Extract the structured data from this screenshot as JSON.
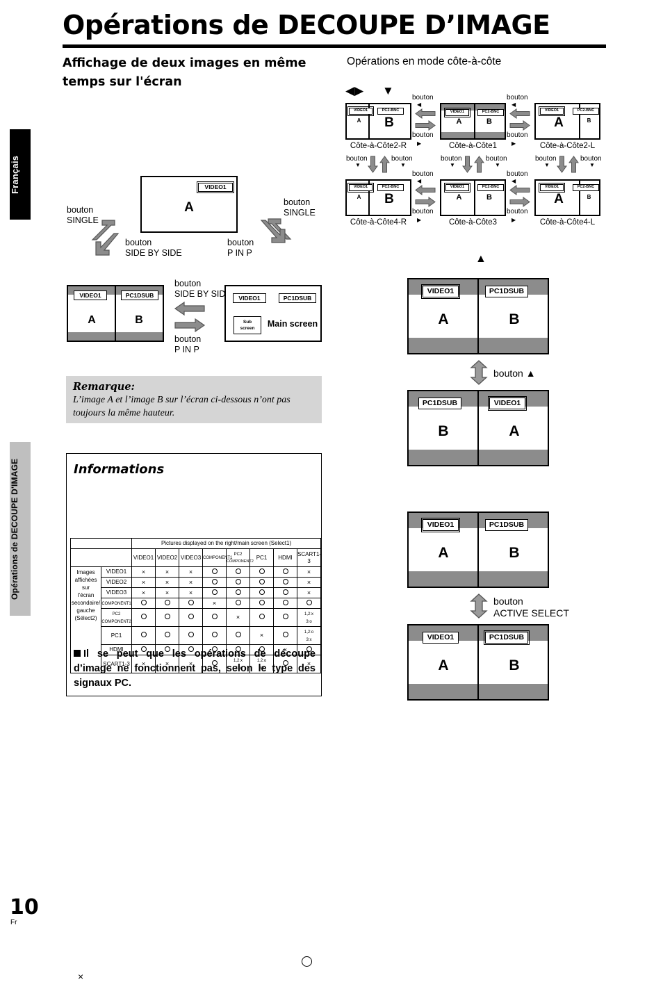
{
  "page": {
    "title_part1": "Opérations de ",
    "title_part2": "DECOUPE D’IMAGE",
    "number": "10",
    "number_sub": "Fr",
    "side_tab_language": "Français",
    "side_tab_section": "Opérations de DECOUPE D'IMAGE"
  },
  "headings": {
    "left": "Affichage de deux images en même temps sur l'écran",
    "right": "Opérations en mode côte-à-côte"
  },
  "labels": {
    "bouton": "bouton",
    "bouton_single": "bouton\nSINGLE",
    "single": "SINGLE",
    "side_by_side": "SIDE BY SIDE",
    "p_in_p": "P IN P",
    "active_select": "ACTIVE SELECT",
    "bouton_up": "bouton ▲",
    "left_right_arrows": "◀▶",
    "down_arrow": "▼",
    "up_arrow": "▲",
    "left_tri": "◀",
    "right_tri": "▶",
    "down_tri": "▼",
    "up_tri": "▲"
  },
  "single_screen": {
    "tag": "VIDEO1",
    "letter": "A",
    "left_btn_top": "bouton",
    "left_btn_top2": "SINGLE",
    "left_btn_bot": "bouton",
    "left_btn_bot2": "SIDE BY SIDE",
    "right_btn_top": "bouton",
    "right_btn_top2": "SINGLE",
    "right_btn_bot": "bouton",
    "right_btn_bot2": "P IN P"
  },
  "sbs_pip": {
    "left_screen": {
      "tag_a": "VIDEO1",
      "tag_b": "PC1DSUB",
      "letter_a": "A",
      "letter_b": "B"
    },
    "arrow_up_label1": "bouton",
    "arrow_up_label2": "SIDE BY SIDE",
    "arrow_down_label1": "bouton",
    "arrow_down_label2": "P IN P",
    "right_screen": {
      "tag_a": "VIDEO1",
      "tag_b": "PC1DSUB",
      "sub": "Sub\nscreen",
      "sub_l1": "Sub",
      "sub_l2": "screen",
      "main": "Main screen"
    }
  },
  "remarque": {
    "title": "Remarque:",
    "body": "L’image A et l’image B sur l’écran ci-dessous n’ont pas toujours la même hauteur."
  },
  "informations": {
    "title": "Informations",
    "legend_x": "×",
    "footnote": "Il se peut que les opérations de découpe d’image ne fonctionnent pas, selon le type des signaux PC.",
    "table": {
      "top_header": "Pictures displayed on the right/main screen (Select1)",
      "row_group_label": "Images affichées sur l’écran secondaire/ gauche (Sélect2)",
      "columns": [
        "VIDEO1",
        "VIDEO2",
        "VIDEO3",
        "COMPONENT1",
        "PC2 COMPONENT2",
        "PC1",
        "HDMI",
        "SCART1-3"
      ],
      "col_pc2_l1": "PC2",
      "col_pc2_l2": "COMPONENT2",
      "rows": [
        {
          "label": "VIDEO1",
          "cells": [
            "x",
            "x",
            "x",
            "o",
            "o",
            "o",
            "o",
            "x"
          ]
        },
        {
          "label": "VIDEO2",
          "cells": [
            "x",
            "x",
            "x",
            "o",
            "o",
            "o",
            "o",
            "x"
          ]
        },
        {
          "label": "VIDEO3",
          "cells": [
            "x",
            "x",
            "x",
            "o",
            "o",
            "o",
            "o",
            "x"
          ]
        },
        {
          "label": "COMPONENT1",
          "cells": [
            "o",
            "o",
            "o",
            "x",
            "o",
            "o",
            "o",
            "o"
          ]
        },
        {
          "label": "PC2 COMPONENT2",
          "label_l1": "PC2",
          "label_l2": "COMPONENT2",
          "cells": [
            "o",
            "o",
            "o",
            "o",
            "x",
            "o",
            "o",
            "1,2:x 3:o"
          ]
        },
        {
          "label": "PC1",
          "cells": [
            "o",
            "o",
            "o",
            "o",
            "o",
            "x",
            "o",
            "1,2:o 3:x"
          ]
        },
        {
          "label": "HDMI",
          "cells": [
            "o",
            "o",
            "o",
            "o",
            "o",
            "o",
            "x",
            "o"
          ]
        },
        {
          "label": "SCART1-3",
          "cells": [
            "x",
            "x",
            "x",
            "o",
            "1,2:x 3:o",
            "1,2:o 3:x",
            "o",
            "x"
          ]
        }
      ]
    }
  },
  "cote_grid": {
    "cells": [
      {
        "caption": "Côte-à-Côte2-R",
        "tag_a": "VIDEO1",
        "tag_b": "PC2-BNC",
        "letter_a": "A",
        "letter_b": "B",
        "variant": "right-big"
      },
      {
        "caption": "Côte-à-Côte1",
        "tag_a": "VIDEO1",
        "tag_b": "PC2-BNC",
        "letter_a": "A",
        "letter_b": "B",
        "variant": "even-band"
      },
      {
        "caption": "Côte-à-Côte2-L",
        "tag_a": "VIDEO1",
        "tag_b": "PC2-BNC",
        "letter_a": "A",
        "letter_b": "B",
        "variant": "left-big"
      },
      {
        "caption": "Côte-à-Côte4-R",
        "tag_a": "VIDEO1",
        "tag_b": "PC2-BNC",
        "letter_a": "A",
        "letter_b": "B",
        "variant": "right-big"
      },
      {
        "caption": "Côte-à-Côte3",
        "tag_a": "VIDEO1",
        "tag_b": "PC2-BNC",
        "letter_a": "A",
        "letter_b": "B",
        "variant": "even"
      },
      {
        "caption": "Côte-à-Côte4-L",
        "tag_a": "VIDEO1",
        "tag_b": "PC2-BNC",
        "letter_a": "A",
        "letter_b": "B",
        "variant": "left-big"
      }
    ]
  },
  "big_screens": {
    "s1": {
      "tag_a": "VIDEO1",
      "tag_b": "PC1DSUB",
      "letter_a": "A",
      "letter_b": "B",
      "selected": "a"
    },
    "s2": {
      "tag_a": "PC1DSUB",
      "tag_b": "VIDEO1",
      "letter_a": "B",
      "letter_b": "A",
      "selected": "b"
    },
    "s3": {
      "tag_a": "VIDEO1",
      "tag_b": "PC1DSUB",
      "letter_a": "A",
      "letter_b": "B",
      "selected": "a"
    },
    "s4": {
      "tag_a": "VIDEO1",
      "tag_b": "PC1DSUB",
      "letter_a": "A",
      "letter_b": "B",
      "selected": "b"
    },
    "arrow1_label": "bouton ▲",
    "arrow2_label_l1": "bouton",
    "arrow2_label_l2": "ACTIVE SELECT"
  }
}
